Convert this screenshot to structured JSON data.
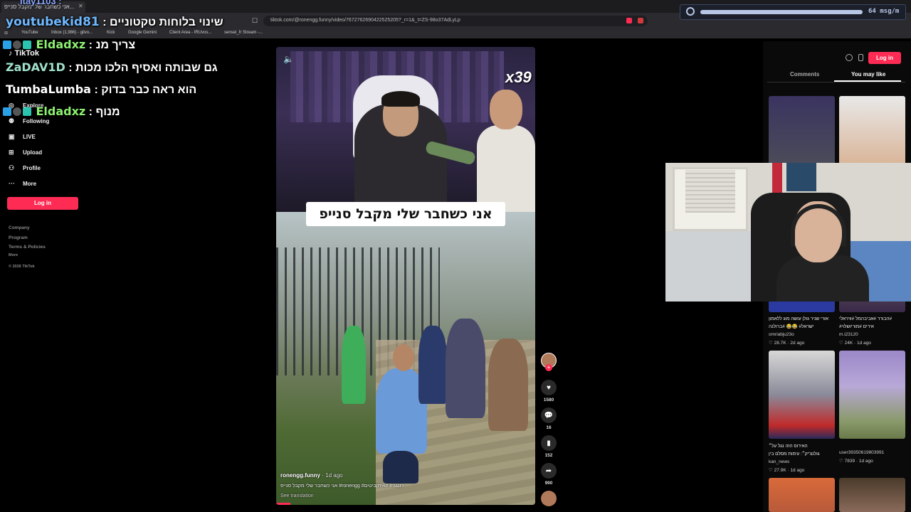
{
  "browser": {
    "active_tab_title": "אני כשחבר שלי מקבל סנייפ...",
    "url": "tiktok.com/@ronengg.funny/video/7672762690422525205?_r=1&_t=ZS-98o37AdLyLp",
    "bookmarks": [
      "YouTube",
      "Inbox (1,986) - gilvo...",
      "Kick",
      "Google Gemini",
      "Client Area - IRUvos...",
      "sensei_fr Stream -..."
    ]
  },
  "stream_widget": {
    "rate_text": "64 msg/m",
    "accent": "#b8c6e6"
  },
  "chat": {
    "top_partial": "Itay1103 :",
    "messages": [
      {
        "user": "youtubekid81",
        "text": ": שינוי בלוחות טקטוניים",
        "user_color": "#6fb8ff"
      },
      {
        "user": "Eldadxz",
        "text": ": צריך מנ",
        "user_color": "#8cf070"
      },
      {
        "user": "ZaDAV1D",
        "text": ": גם שבותה ואסיף הלכו מכות",
        "user_color": "#9fe0c8"
      },
      {
        "user": "TumbaLumba",
        "text": ": הוא ראה כבר בדוק",
        "user_color": "#ffffff"
      },
      {
        "user": "Eldadxz",
        "text": ": מנוף",
        "user_color": "#8cf070"
      }
    ]
  },
  "tiktok_sidebar": {
    "logo": "TikTok",
    "items": [
      {
        "icon": "compass-icon",
        "glyph": "◎",
        "label": "Explore"
      },
      {
        "icon": "following-icon",
        "glyph": "👥",
        "label": "Following"
      },
      {
        "icon": "live-icon",
        "glyph": "▣",
        "label": "LIVE"
      },
      {
        "icon": "upload-icon",
        "glyph": "⊞",
        "label": "Upload"
      },
      {
        "icon": "profile-icon",
        "glyph": "⚇",
        "label": "Profile"
      },
      {
        "icon": "more-icon",
        "glyph": "···",
        "label": "More"
      }
    ],
    "login_label": "Log in",
    "footer": [
      "Company",
      "Program",
      "Terms & Policies",
      "More",
      "© 2026 TikTok"
    ]
  },
  "video": {
    "overlay_counter": "x39",
    "caption": "אני כשחבר שלי מקבל סנייפ",
    "username": "ronengg.funny",
    "ago": "· 1d ago",
    "description": "אני כשחבר שלי מקבל סנייפ #ronengg #רונגגי# #איתןביטים",
    "see_translation": "See translation"
  },
  "actions": {
    "likes": "1580",
    "comments": "16",
    "saves": "152",
    "shares": "990"
  },
  "right_panel": {
    "login_label": "Log in",
    "tabs": [
      "Comments",
      "You may like"
    ],
    "thumbs": [
      {
        "title": "אורי שניר גולן עושה מוג ללאמון",
        "title2": "ישראל# 😂😂 #ברולנה",
        "user": "omriabju23o",
        "likes": "28.7K",
        "ago": "2d ago"
      },
      {
        "title": "הבורר #אביבהמל #וויראלי#",
        "title2": "#אירים #מוריושלוי",
        "user": "m.i23120",
        "likes": "24K",
        "ago": "1d ago"
      },
      {
        "title": "האירוס הזה נגל על״",
        "title2": "גולנצ'יק״: עימות מסלם בין",
        "user": "kan_news",
        "likes": "27.9K",
        "ago": "1d ago"
      },
      {
        "title": "",
        "title2": "",
        "user": "user39350619803991",
        "likes": "7839",
        "ago": "1d ago"
      }
    ]
  }
}
